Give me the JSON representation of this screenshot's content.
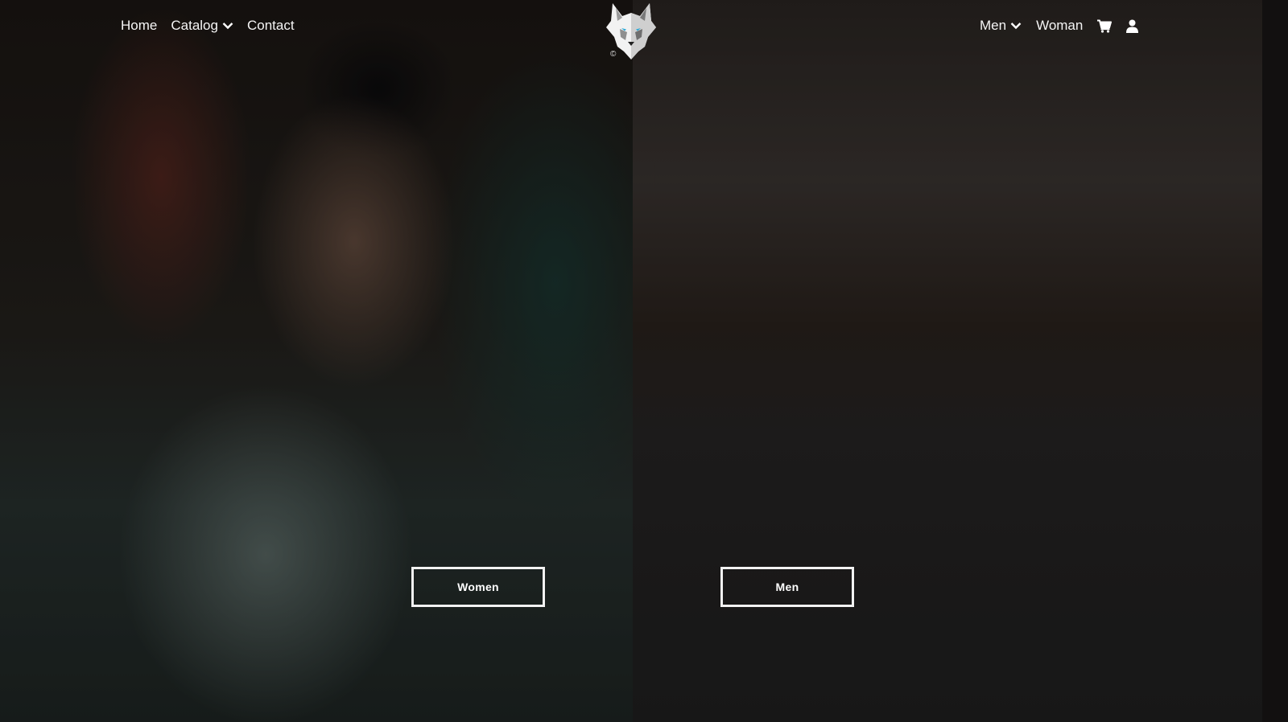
{
  "nav": {
    "left": [
      {
        "label": "Home",
        "dropdown": false
      },
      {
        "label": "Catalog",
        "dropdown": true
      },
      {
        "label": "Contact",
        "dropdown": false
      }
    ],
    "right": [
      {
        "label": "Men",
        "dropdown": true
      },
      {
        "label": "Woman",
        "dropdown": false
      }
    ],
    "icons": {
      "cart": "cart-icon",
      "account": "user-icon"
    }
  },
  "logo": {
    "name": "wolf-logo",
    "copyright": "©",
    "accent_eye": "#2aa8d6"
  },
  "hero": {
    "women": {
      "button_label": "Women",
      "image": "woman-in-hat-white-sweater-photo"
    },
    "men": {
      "button_label": "Men",
      "image": "man-in-brown-coat-on-road-photo"
    }
  }
}
